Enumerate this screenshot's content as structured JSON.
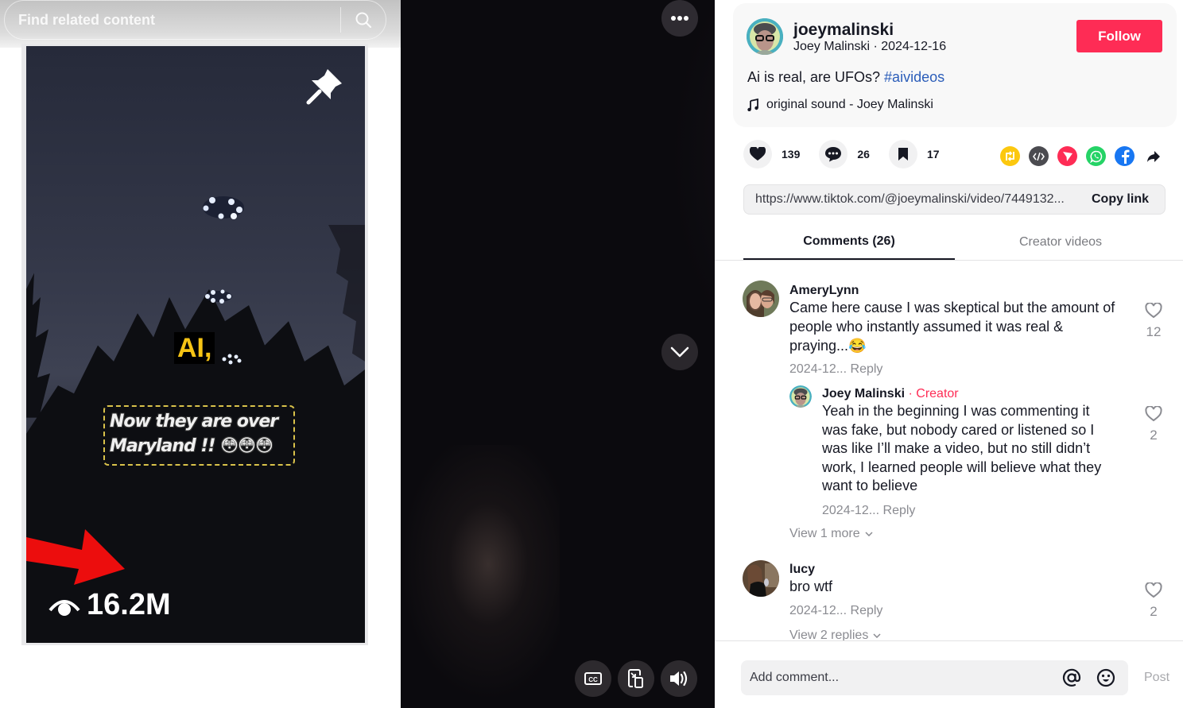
{
  "search": {
    "placeholder": "Find related content"
  },
  "video": {
    "overlay_label": "AI,",
    "caption_line1": "Now they are over",
    "caption_line2": "Maryland !! 😳😳😳",
    "view_count": "16.2M"
  },
  "controls": {
    "more_icon": "ellipsis-icon",
    "next_icon": "chevron-down-icon",
    "captions_icon": "closed-captions-icon",
    "miniplayer_icon": "picture-in-picture-icon",
    "volume_icon": "volume-icon"
  },
  "post": {
    "handle": "joeymalinski",
    "display_name": "Joey Malinski",
    "date": "2024-12-16",
    "subline": "Joey Malinski · 2024-12-16",
    "follow_label": "Follow",
    "description_text": "Ai is real, are UFOs? ",
    "hashtag": "#aivideos",
    "music": "original sound - Joey Malinski"
  },
  "stats": {
    "likes": "139",
    "comments": "26",
    "saves": "17"
  },
  "share": {
    "targets": [
      "repost",
      "embed",
      "send-to-friends",
      "whatsapp",
      "facebook",
      "more-share"
    ]
  },
  "link": {
    "url": "https://www.tiktok.com/@joeymalinski/video/7449132...",
    "copy_label": "Copy link"
  },
  "tabs": [
    {
      "label": "Comments (26)",
      "active": true
    },
    {
      "label": "Creator videos",
      "active": false
    }
  ],
  "comments": [
    {
      "author": "AmeryLynn",
      "text_lines": [
        "Came here cause I was skeptical but the amount of",
        "people who instantly assumed it was real &",
        "praying...😂"
      ],
      "date": "2024-12...",
      "reply_label": "Reply",
      "likes": "12",
      "replies": [
        {
          "author": "Joey Malinski",
          "badge": " · Creator",
          "text_lines": [
            "Yeah in the beginning I was commenting it",
            "was fake, but nobody cared or listened so I",
            "was like I’ll make a video, but no still didn’t",
            "work, I learned people will believe what they",
            "want to believe"
          ],
          "date": "2024-12...",
          "reply_label": "Reply",
          "likes": "2"
        }
      ],
      "view_more_label": "View 1 more"
    },
    {
      "author": "lucy",
      "text_lines": [
        "bro wtf"
      ],
      "date": "2024-12...",
      "reply_label": "Reply",
      "likes": "2",
      "view_more_label": "View 2 replies"
    }
  ],
  "composer": {
    "placeholder": "Add comment...",
    "post_label": "Post"
  },
  "colors": {
    "accent": "#fe2c55",
    "hashtag": "#2b5db9",
    "text": "#161823",
    "muted": "#8a8b91"
  }
}
